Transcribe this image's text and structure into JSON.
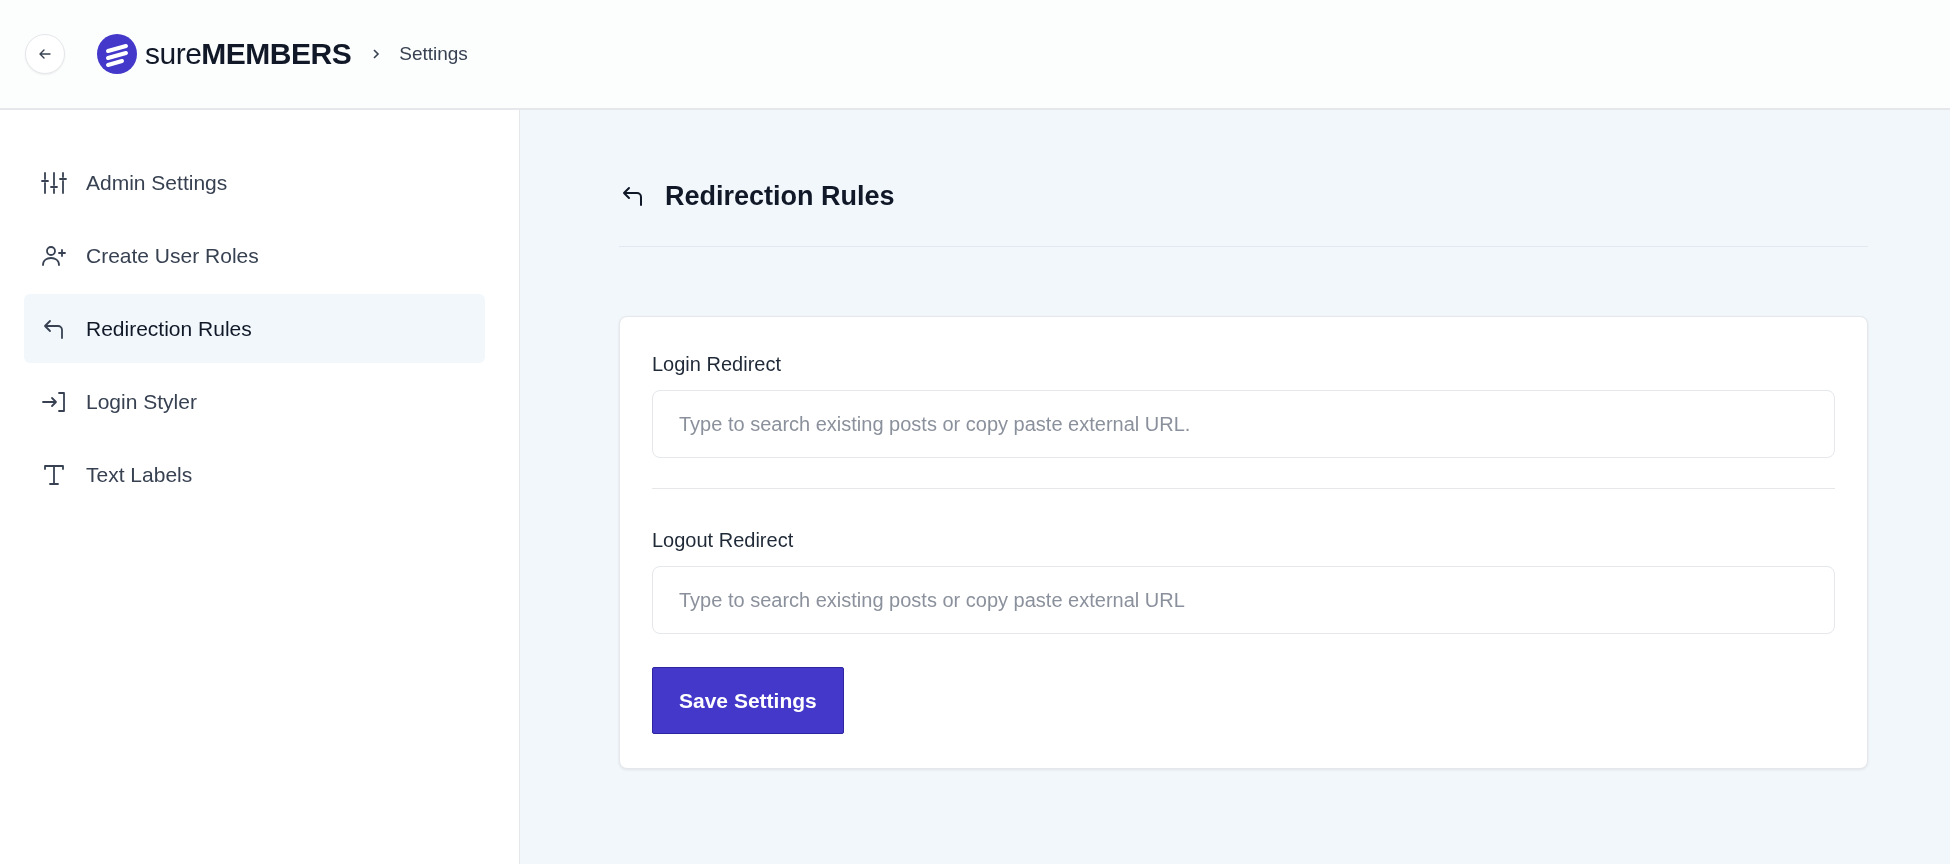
{
  "header": {
    "brand": {
      "light": "sure",
      "bold": "MEMBERS"
    },
    "breadcrumb": "Settings"
  },
  "sidebar": {
    "items": [
      {
        "label": "Admin Settings",
        "kind": "sliders",
        "selected": false
      },
      {
        "label": "Create User Roles",
        "kind": "userplus",
        "selected": false
      },
      {
        "label": "Redirection Rules",
        "kind": "return",
        "selected": true
      },
      {
        "label": "Login Styler",
        "kind": "login",
        "selected": false
      },
      {
        "label": "Text Labels",
        "kind": "text",
        "selected": false
      }
    ]
  },
  "main": {
    "title": "Redirection Rules",
    "fields": [
      {
        "label": "Login Redirect",
        "placeholder": "Type to search existing posts or copy paste external URL."
      },
      {
        "label": "Logout Redirect",
        "placeholder": "Type to search existing posts or copy paste external URL"
      }
    ],
    "button": "Save Settings"
  }
}
